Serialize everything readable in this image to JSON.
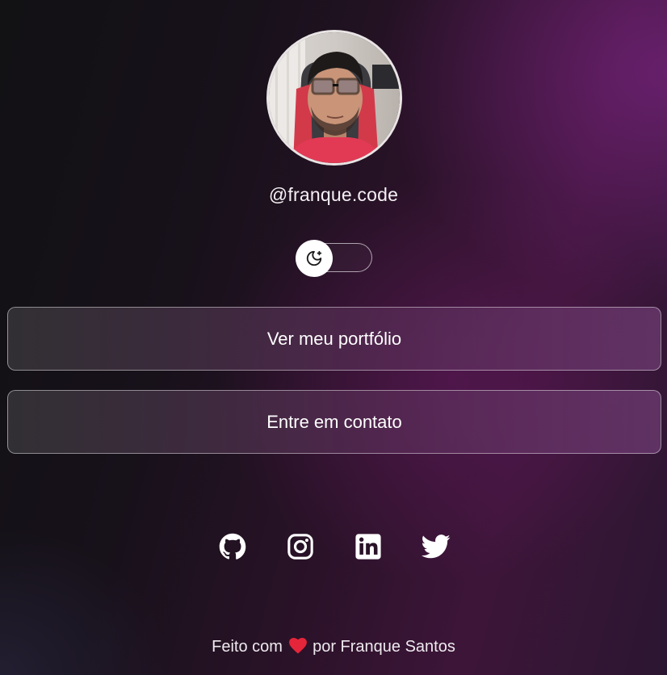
{
  "profile": {
    "handle": "@franque.code",
    "avatar_alt": "profile-photo"
  },
  "theme_toggle": {
    "icon": "moon-sparkle-icon",
    "state": "dark"
  },
  "links": [
    {
      "label": "Ver meu portfólio"
    },
    {
      "label": "Entre em contato"
    }
  ],
  "social": [
    {
      "icon": "github-icon"
    },
    {
      "icon": "instagram-icon"
    },
    {
      "icon": "linkedin-icon"
    },
    {
      "icon": "twitter-icon"
    }
  ],
  "footer": {
    "prefix": "Feito com",
    "heart_color": "#e5253a",
    "suffix": "por Franque Santos"
  },
  "colors": {
    "accent_purple": "#5a1c5e",
    "background_dark": "#121114",
    "text": "#ffffff"
  }
}
